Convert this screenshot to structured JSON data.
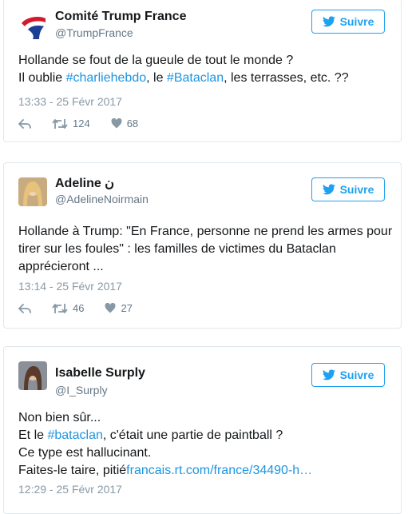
{
  "follow_label": "Suivre",
  "tweets": [
    {
      "name": "Comité Trump France",
      "handle": "@TrumpFrance",
      "lines": [
        [
          {
            "t": "Hollande se fout de la gueule de tout le monde ?"
          }
        ],
        [
          {
            "t": "Il oublie "
          },
          {
            "t": "#charliehebdo",
            "tag": true
          },
          {
            "t": ", le "
          },
          {
            "t": "#Bataclan",
            "tag": true
          },
          {
            "t": ", les terrasses, etc. ??"
          }
        ]
      ],
      "timestamp": "13:33 - 25 Févr 2017",
      "retweets": "124",
      "likes": "68"
    },
    {
      "name": "Adeline",
      "name_suffix": "ن",
      "handle": "@AdelineNoirmain",
      "lines": [
        [
          {
            "t": "Hollande à Trump: \"En France, personne ne prend les armes pour"
          }
        ],
        [
          {
            "t": "tirer sur les foules\" : les familles de victimes du Bataclan"
          }
        ],
        [
          {
            "t": "apprécieront ..."
          }
        ]
      ],
      "timestamp": "13:14 - 25 Févr 2017",
      "retweets": "46",
      "likes": "27"
    },
    {
      "name": "Isabelle Surply",
      "handle": "@I_Surply",
      "lines": [
        [
          {
            "t": "Non bien sûr..."
          }
        ],
        [
          {
            "t": "Et le "
          },
          {
            "t": "#bataclan",
            "tag": true
          },
          {
            "t": ", c'était une partie de paintball ?"
          }
        ],
        [
          {
            "t": "Ce type est hallucinant."
          }
        ],
        [
          {
            "t": "Faites-le taire, pitié"
          },
          {
            "t": "francais.rt.com/france/34490-h…",
            "tag": true
          }
        ]
      ],
      "timestamp": "12:29 - 25 Févr 2017"
    }
  ],
  "colors": {
    "accent": "#1da1f2",
    "link": "#1b95e0",
    "muted": "#657786"
  }
}
